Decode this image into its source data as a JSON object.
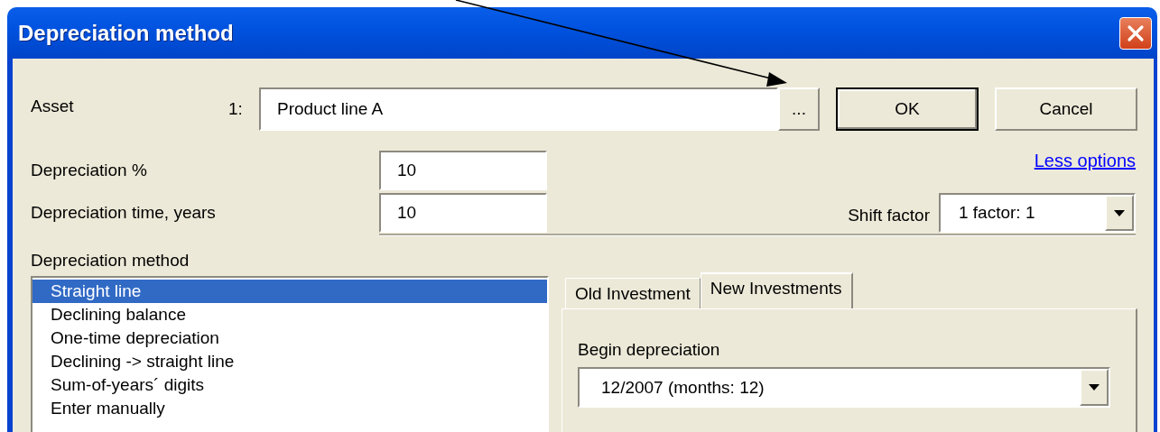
{
  "window": {
    "title": "Depreciation method"
  },
  "asset": {
    "label": "Asset",
    "number": "1:",
    "value": "Product line A",
    "browse_button": "...",
    "ok_button": "OK",
    "cancel_button": "Cancel"
  },
  "depreciation_percent": {
    "label": "Depreciation %",
    "value": "10"
  },
  "less_options_link": "Less options",
  "depreciation_time": {
    "label": "Depreciation time, years",
    "value": "10"
  },
  "shift_factor": {
    "label": "Shift factor",
    "value": "1 factor: 1"
  },
  "method": {
    "label": "Depreciation method",
    "items": [
      {
        "label": "Straight line",
        "selected": true
      },
      {
        "label": "Declining balance",
        "selected": false
      },
      {
        "label": "One-time depreciation",
        "selected": false
      },
      {
        "label": "Declining -> straight line",
        "selected": false
      },
      {
        "label": "Sum-of-years´ digits",
        "selected": false
      },
      {
        "label": "Enter manually",
        "selected": false
      }
    ]
  },
  "tabs": [
    {
      "label": "Old Investment",
      "selected": false
    },
    {
      "label": "New Investments",
      "selected": true
    }
  ],
  "begin_depreciation": {
    "label": "Begin depreciation",
    "value": "12/2007 (months: 12)"
  }
}
